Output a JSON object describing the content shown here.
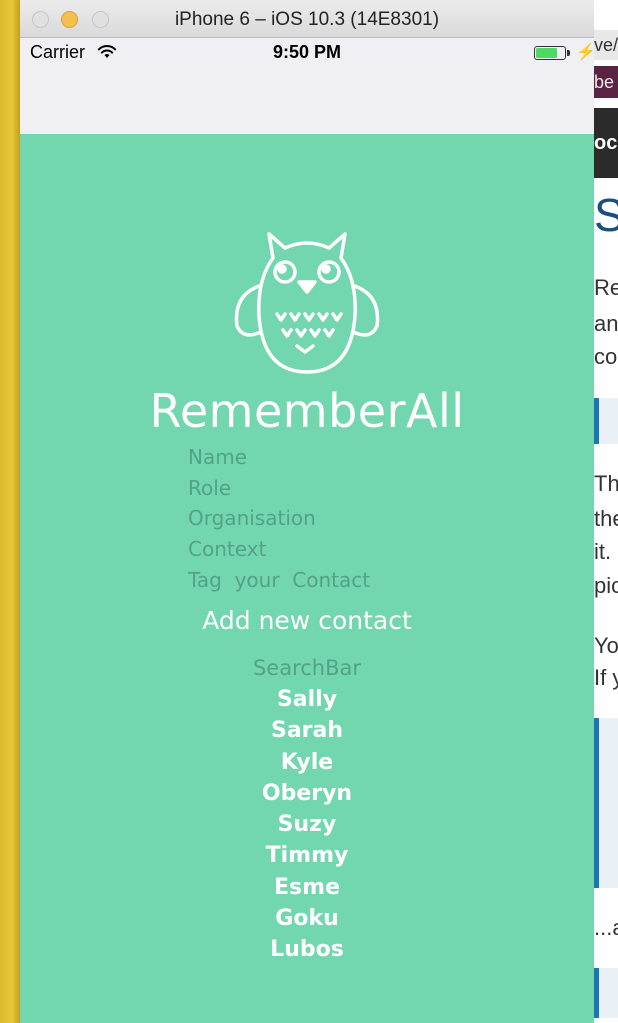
{
  "window": {
    "title": "iPhone 6 – iOS 10.3 (14E8301)"
  },
  "status_bar": {
    "carrier": "Carrier",
    "time": "9:50 PM",
    "battery_color": "#4cd964"
  },
  "background_page": {
    "address_fragment": "ve/",
    "bar1_fragment": "be",
    "bar2_fragment": "ocs",
    "heading_fragment": "S",
    "text_lines": [
      "Re",
      "an",
      "co",
      "Th",
      "the",
      "it.",
      "pic",
      "Yo",
      "If y",
      "...a"
    ]
  },
  "app": {
    "background_color": "#72d6af",
    "logo_icon": "owl-icon",
    "title": "RememberAll",
    "fields": {
      "name_placeholder": "Name",
      "role_placeholder": "Role",
      "organisation_placeholder": "Organisation",
      "context_placeholder": "Context",
      "tag_placeholder": "Tag  your  Contact"
    },
    "add_button_label": "Add new contact",
    "search_placeholder": "SearchBar",
    "contacts": [
      "Sally",
      "Sarah",
      "Kyle",
      "Oberyn",
      "Suzy",
      "Timmy",
      "Esme",
      "Goku",
      "Lubos"
    ]
  }
}
